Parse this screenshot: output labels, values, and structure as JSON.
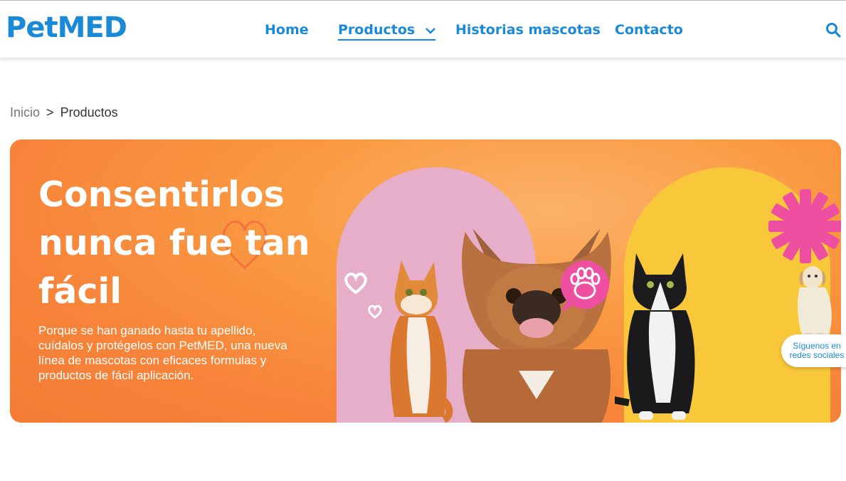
{
  "brand": {
    "name": "PetMED",
    "color": "#1a8ad8"
  },
  "nav": {
    "items": [
      {
        "label": "Home"
      },
      {
        "label": "Productos"
      },
      {
        "label": "Historias mascotas"
      },
      {
        "label": "Contacto"
      }
    ],
    "active": "Productos"
  },
  "search": {
    "icon": "search-icon"
  },
  "breadcrumb": {
    "home": "Inicio",
    "separator": ">",
    "current": "Productos"
  },
  "hero": {
    "title": "Consentirlos nunca fue tan fácil",
    "body": "Porque se han ganado hasta tu apellido, cuídalos y protégelos con PetMED, una nueva línea de mascotas con eficaces formulas y productos de fácil aplicación.",
    "colors": {
      "orange": "#f7843a",
      "pink": "#e6aec9",
      "yellow": "#f9c83a",
      "accent_pink": "#ee4fa0"
    }
  },
  "social": {
    "label": "Síguenos en redes sociales"
  }
}
